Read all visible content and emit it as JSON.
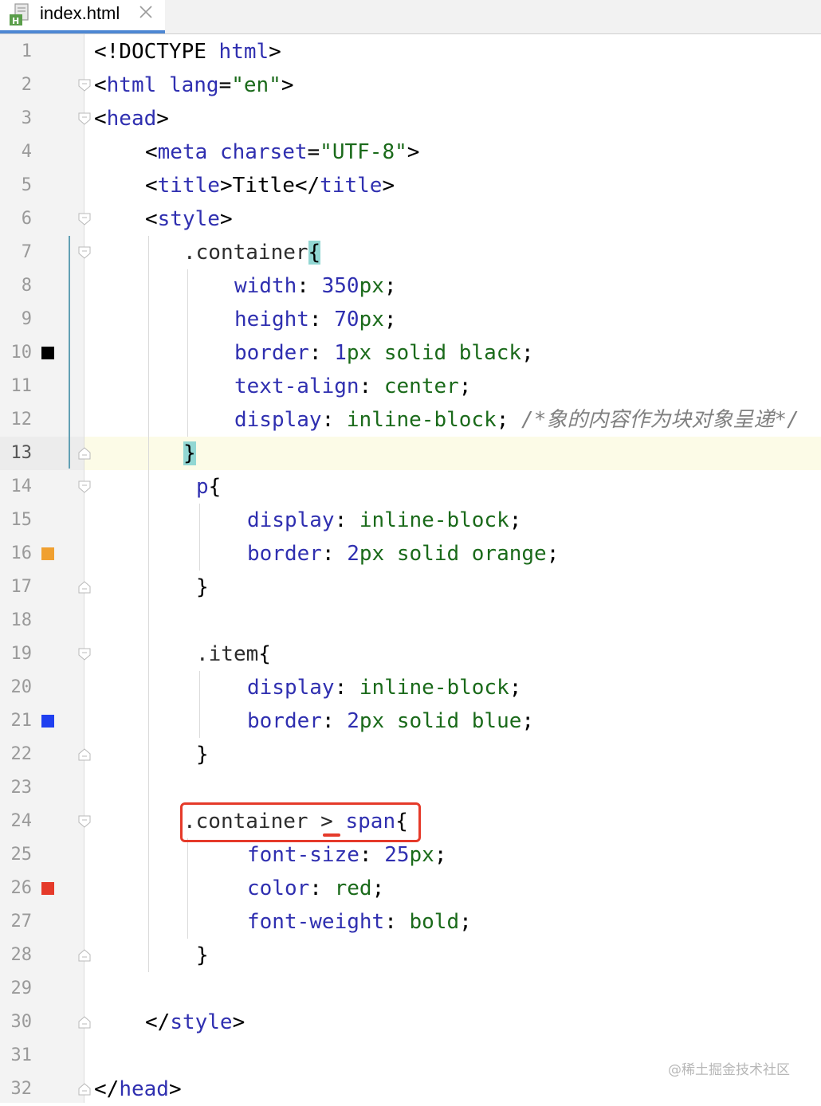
{
  "tab": {
    "file_name": "index.html",
    "icon": "html-file-icon",
    "close_icon": "close-icon"
  },
  "gutter": {
    "line_numbers": [
      "1",
      "2",
      "3",
      "4",
      "5",
      "6",
      "7",
      "8",
      "9",
      "10",
      "11",
      "12",
      "13",
      "14",
      "15",
      "16",
      "17",
      "18",
      "19",
      "20",
      "21",
      "22",
      "23",
      "24",
      "25",
      "26",
      "27",
      "28",
      "29",
      "30",
      "31",
      "32"
    ],
    "current_line": 13,
    "color_swatches": [
      {
        "line": 10,
        "color": "#000000"
      },
      {
        "line": 16,
        "color": "#f0a030"
      },
      {
        "line": 21,
        "color": "#1f3ff0"
      },
      {
        "line": 26,
        "color": "#e53a2a"
      }
    ]
  },
  "code": [
    [
      [
        "t",
        "<!DOCTYPE "
      ],
      [
        "tg",
        "html"
      ],
      [
        "t",
        ">"
      ]
    ],
    [
      [
        "t",
        "<"
      ],
      [
        "tg",
        "html"
      ],
      [
        "t",
        " "
      ],
      [
        "at",
        "lang"
      ],
      [
        "t",
        "="
      ],
      [
        "av",
        "\"en\""
      ],
      [
        "t",
        ">"
      ]
    ],
    [
      [
        "t",
        "<"
      ],
      [
        "tg",
        "head"
      ],
      [
        "t",
        ">"
      ]
    ],
    [
      [
        "t",
        "<"
      ],
      [
        "tg",
        "meta"
      ],
      [
        "t",
        " "
      ],
      [
        "at",
        "charset"
      ],
      [
        "t",
        "="
      ],
      [
        "av",
        "\"UTF-8\""
      ],
      [
        "t",
        ">"
      ]
    ],
    [
      [
        "t",
        "<"
      ],
      [
        "tg",
        "title"
      ],
      [
        "t",
        ">Title</"
      ],
      [
        "tg",
        "title"
      ],
      [
        "t",
        ">"
      ]
    ],
    [
      [
        "t",
        "<"
      ],
      [
        "tg",
        "style"
      ],
      [
        "t",
        ">"
      ]
    ],
    [
      [
        "sel",
        ".container"
      ],
      [
        "brhl",
        "{"
      ]
    ],
    [
      [
        "pr",
        "width"
      ],
      [
        "t",
        ": "
      ],
      [
        "nm",
        "350"
      ],
      [
        "un",
        "px"
      ],
      [
        "t",
        ";"
      ]
    ],
    [
      [
        "pr",
        "height"
      ],
      [
        "t",
        ": "
      ],
      [
        "nm",
        "70"
      ],
      [
        "un",
        "px"
      ],
      [
        "t",
        ";"
      ]
    ],
    [
      [
        "pr",
        "border"
      ],
      [
        "t",
        ": "
      ],
      [
        "nm",
        "1"
      ],
      [
        "un",
        "px"
      ],
      [
        "t",
        " "
      ],
      [
        "vl",
        "solid black"
      ],
      [
        "t",
        ";"
      ]
    ],
    [
      [
        "pr",
        "text-align"
      ],
      [
        "t",
        ": "
      ],
      [
        "vl",
        "center"
      ],
      [
        "t",
        ";"
      ]
    ],
    [
      [
        "pr",
        "display"
      ],
      [
        "t",
        ": "
      ],
      [
        "vl",
        "inline-block"
      ],
      [
        "t",
        "; "
      ],
      [
        "cm",
        "/*象的内容作为块对象呈递*/"
      ]
    ],
    [
      [
        "brhl",
        "}"
      ]
    ],
    [
      [
        "tg",
        "p"
      ],
      [
        "t",
        "{"
      ]
    ],
    [
      [
        "pr",
        "display"
      ],
      [
        "t",
        ": "
      ],
      [
        "vl",
        "inline-block"
      ],
      [
        "t",
        ";"
      ]
    ],
    [
      [
        "pr",
        "border"
      ],
      [
        "t",
        ": "
      ],
      [
        "nm",
        "2"
      ],
      [
        "un",
        "px"
      ],
      [
        "t",
        " "
      ],
      [
        "vl",
        "solid orange"
      ],
      [
        "t",
        ";"
      ]
    ],
    [
      [
        "t",
        "}"
      ]
    ],
    [],
    [
      [
        "sel",
        ".item"
      ],
      [
        "t",
        "{"
      ]
    ],
    [
      [
        "pr",
        "display"
      ],
      [
        "t",
        ": "
      ],
      [
        "vl",
        "inline-block"
      ],
      [
        "t",
        ";"
      ]
    ],
    [
      [
        "pr",
        "border"
      ],
      [
        "t",
        ": "
      ],
      [
        "nm",
        "2"
      ],
      [
        "un",
        "px"
      ],
      [
        "t",
        " "
      ],
      [
        "vl",
        "solid blue"
      ],
      [
        "t",
        ";"
      ]
    ],
    [
      [
        "t",
        "}"
      ]
    ],
    [],
    [
      [
        "sel",
        ".container > "
      ],
      [
        "tg",
        "span"
      ],
      [
        "t",
        "{"
      ]
    ],
    [
      [
        "pr",
        "font-size"
      ],
      [
        "t",
        ": "
      ],
      [
        "nm",
        "25"
      ],
      [
        "un",
        "px"
      ],
      [
        "t",
        ";"
      ]
    ],
    [
      [
        "pr",
        "color"
      ],
      [
        "t",
        ": "
      ],
      [
        "vl",
        "red"
      ],
      [
        "t",
        ";"
      ]
    ],
    [
      [
        "pr",
        "font-weight"
      ],
      [
        "t",
        ": "
      ],
      [
        "vl",
        "bold"
      ],
      [
        "t",
        ";"
      ]
    ],
    [
      [
        "t",
        "}"
      ]
    ],
    [],
    [
      [
        "t",
        "</"
      ],
      [
        "tg",
        "style"
      ],
      [
        "t",
        ">"
      ]
    ],
    [],
    [
      [
        "t",
        "</"
      ],
      [
        "tg",
        "head"
      ],
      [
        "t",
        ">"
      ]
    ]
  ],
  "watermark": "@稀土掘金技术社区"
}
